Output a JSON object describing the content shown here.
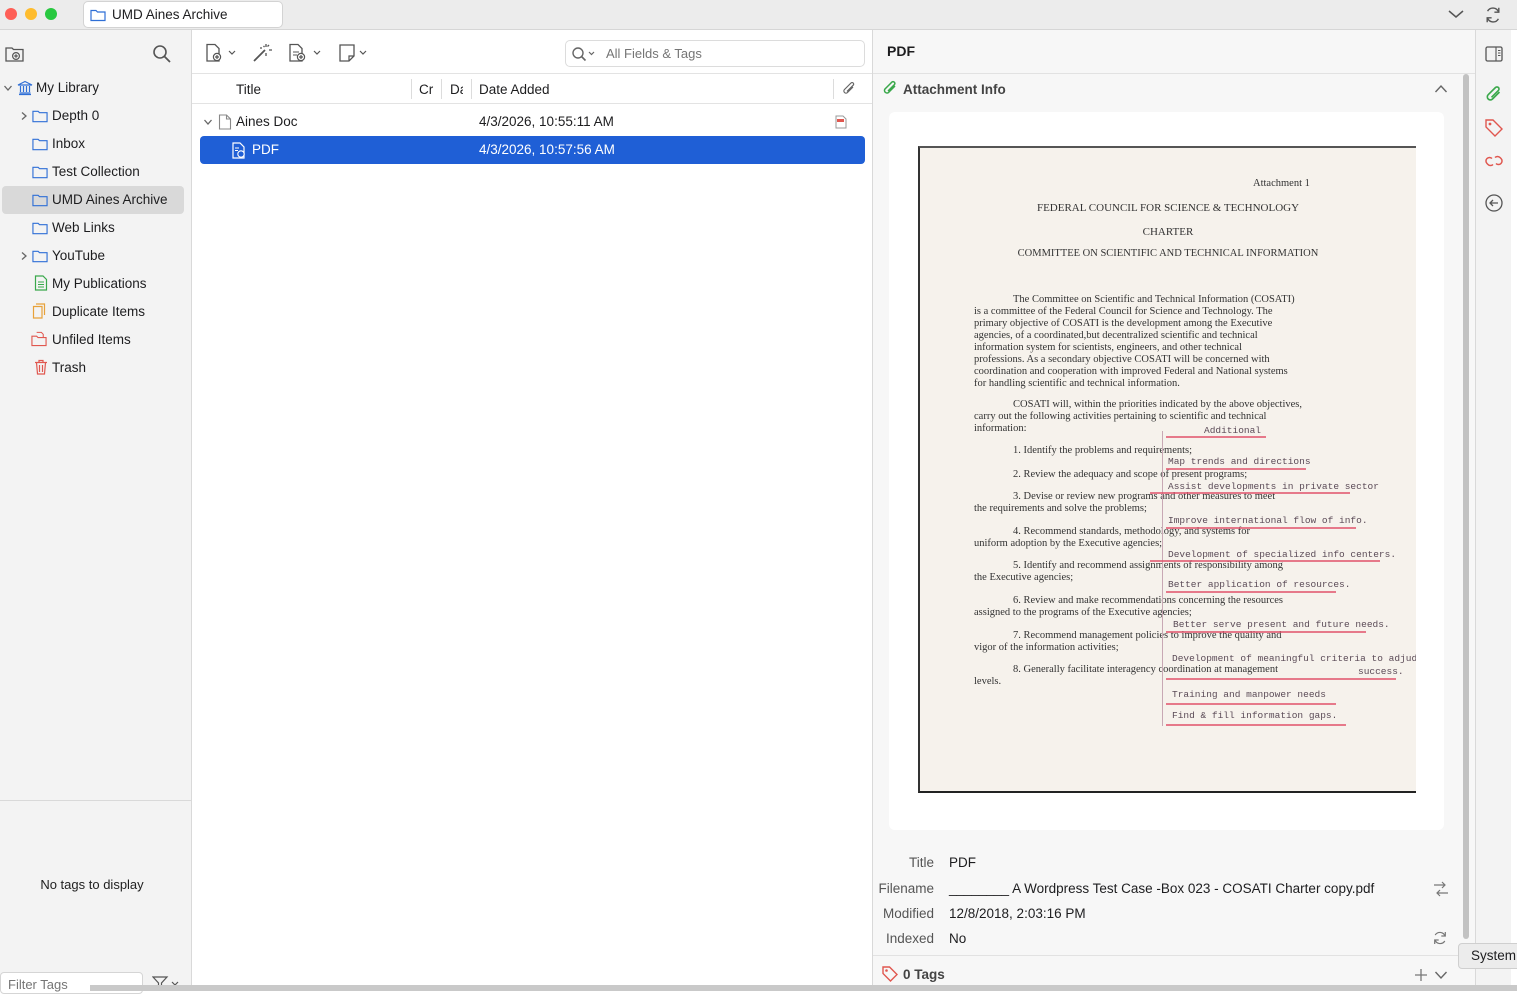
{
  "window": {
    "tab_title": "UMD Aines Archive"
  },
  "colors": {
    "selection_blue": "#1f5fd6",
    "collection_icon": "#2f6fd6",
    "publications_icon": "#3aa84b",
    "duplicates_icon": "#e7a23a",
    "unfiled_icon": "#e0574f",
    "trash_icon": "#e0574f",
    "attachment_icon": "#3aa84b",
    "tag_icon": "#e0574f"
  },
  "sidebar": {
    "library": "My Library",
    "items": [
      {
        "label": "Depth 0",
        "icon": "folder-icon",
        "expandable": true
      },
      {
        "label": "Inbox",
        "icon": "folder-icon",
        "expandable": false
      },
      {
        "label": "Test Collection",
        "icon": "folder-icon",
        "expandable": false
      },
      {
        "label": "UMD Aines Archive",
        "icon": "folder-icon",
        "expandable": false,
        "selected": true
      },
      {
        "label": "Web Links",
        "icon": "folder-icon",
        "expandable": false
      },
      {
        "label": "YouTube",
        "icon": "folder-icon",
        "expandable": true
      },
      {
        "label": "My Publications",
        "icon": "publications-icon"
      },
      {
        "label": "Duplicate Items",
        "icon": "duplicates-icon"
      },
      {
        "label": "Unfiled Items",
        "icon": "unfiled-icon"
      },
      {
        "label": "Trash",
        "icon": "trash-icon"
      }
    ],
    "no_tags": "No tags to display",
    "filter_placeholder": "Filter Tags"
  },
  "items_pane": {
    "search_placeholder": "All Fields & Tags",
    "columns": {
      "title": "Title",
      "creator": "Cr",
      "date": "Da",
      "date_added": "Date Added"
    },
    "rows": [
      {
        "title": "Aines Doc",
        "date_added": "4/3/2026, 10:55:11 AM",
        "expanded": true
      },
      {
        "title": "PDF",
        "date_added": "4/3/2026, 10:57:56 AM",
        "selected": true
      }
    ]
  },
  "item_pane": {
    "header": "PDF",
    "section": "Attachment Info",
    "fields": {
      "title_label": "Title",
      "title_value": "PDF",
      "filename_label": "Filename",
      "filename_value": "________ A Wordpress Test Case -Box 023 - COSATI Charter copy.pdf",
      "modified_label": "Modified",
      "modified_value": "12/8/2018, 2:03:16 PM",
      "indexed_label": "Indexed",
      "indexed_value": "No"
    },
    "tags_header": "0 Tags",
    "tooltip": "System"
  },
  "document": {
    "attachment": "Attachment 1",
    "heading1": "FEDERAL COUNCIL FOR SCIENCE & TECHNOLOGY",
    "heading2": "CHARTER",
    "heading3": "COMMITTEE ON SCIENTIFIC AND TECHNICAL INFORMATION",
    "para1": [
      "The Committee on Scientific and Technical Information (COSATI)",
      "is a committee of the Federal Council for Science and Technology.  The",
      "primary objective of COSATI is the development among the Executive",
      "agencies, of a coordinated,but decentralized scientific and technical",
      "information system for scientists, engineers, and other technical",
      "professions.  As a secondary objective COSATI will be concerned with",
      "coordination and cooperation with improved Federal and National systems",
      "for handling scientific and technical information."
    ],
    "para2": [
      "COSATI will, within the priorities indicated by the above objectives,",
      "carry out the following activities pertaining to scientific and technical",
      "information:"
    ],
    "list": [
      "1.  Identify the problems and requirements;",
      "2.  Review the adequacy and scope of present programs;",
      "3.  Devise or review new programs and other measures to meet",
      "the requirements and solve the problems;",
      "4.  Recommend standards, methodology, and systems for",
      "uniform adoption by the Executive agencies;",
      "5.  Identify and recommend assignments of responsibility among",
      "the Executive agencies;",
      "6.  Review and make recommendations concerning the resources",
      "assigned to the programs of the Executive agencies;",
      "7.  Recommend management policies to improve the quality and",
      "vigor of the information activities;",
      "8.  Generally facilitate interagency coordination at management",
      "levels."
    ],
    "annotations": [
      "Additional",
      "Map  trends and directions",
      "Assist developments in private sector",
      "Improve international flow of info.",
      "Development of specialized info centers.",
      "Better application of resources.",
      "Better serve present and future needs.",
      "Development of meaningful criteria  to adjudge",
      "success.",
      "Training and manpower needs",
      "Find & fill information gaps."
    ]
  }
}
